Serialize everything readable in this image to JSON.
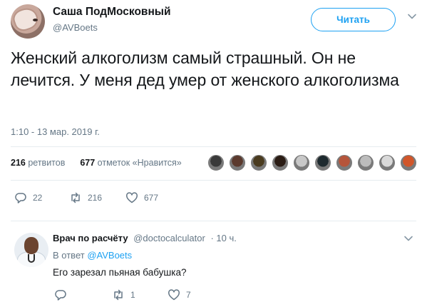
{
  "author": {
    "display_name": "Саша ПодМосковный",
    "handle": "@AVBoets"
  },
  "follow_button": {
    "label": "Читать"
  },
  "tweet": {
    "text": "Женский алкоголизм самый страшный. Он не лечится. У меня дед умер от женского алкоголизма",
    "timestamp": "1:10 - 13 мар. 2019 г."
  },
  "stats": {
    "retweets_count": "216",
    "retweets_label": "ретвитов",
    "likes_count": "677",
    "likes_label": "отметок «Нравится»"
  },
  "liker_avatars": [
    {
      "name": "liker-1",
      "color": "#3a3a3a"
    },
    {
      "name": "liker-2",
      "color": "#5b3a2e"
    },
    {
      "name": "liker-3",
      "color": "#4a3b1f"
    },
    {
      "name": "liker-4",
      "color": "#2a1c14"
    },
    {
      "name": "liker-5",
      "color": "#c8c8c8"
    },
    {
      "name": "liker-6",
      "color": "#1e2a2f"
    },
    {
      "name": "liker-7",
      "color": "#b5553b"
    },
    {
      "name": "liker-8",
      "color": "#bcbcbc"
    },
    {
      "name": "liker-9",
      "color": "#d9d9d9"
    },
    {
      "name": "liker-10",
      "color": "#d1562a"
    }
  ],
  "actions": {
    "replies": "22",
    "retweets": "216",
    "likes": "677"
  },
  "reply": {
    "display_name": "Врач по расчёту",
    "handle": "@doctocalculator",
    "time": "· 10 ч.",
    "reply_to_label": "В ответ",
    "reply_to_handle": "@AVBoets",
    "text": "Его зарезал пьяная бабушка?",
    "actions": {
      "replies": "",
      "retweets": "1",
      "likes": "7"
    }
  },
  "colors": {
    "accent": "#1da1f2",
    "muted": "#657786",
    "text": "#14171a",
    "divider": "#e6ecf0"
  }
}
